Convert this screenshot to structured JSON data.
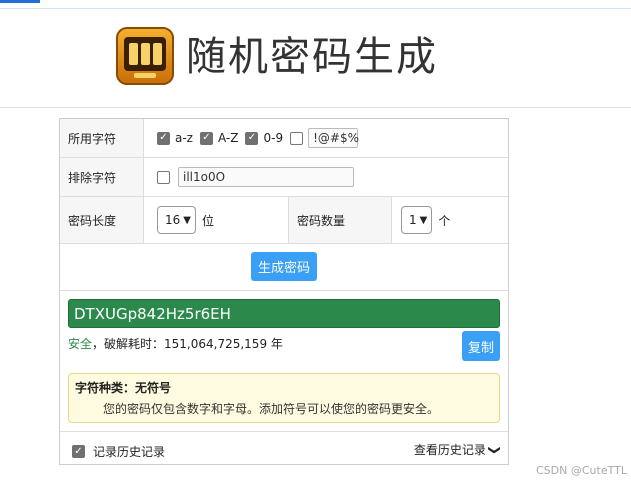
{
  "header": {
    "title": "随机密码生成",
    "logo_icon": "slot-machine-icon"
  },
  "options": {
    "chars_label": "所用字符",
    "lowercase": {
      "label": "a-z",
      "checked": true
    },
    "uppercase": {
      "label": "A-Z",
      "checked": true
    },
    "digits": {
      "label": "0-9",
      "checked": true
    },
    "symbols": {
      "checked": false,
      "value": "!@#$%"
    },
    "exclude_label": "排除字符",
    "exclude": {
      "checked": false,
      "value": "ill1o0O"
    },
    "length_label": "密码长度",
    "length_value": "16",
    "length_unit": "位",
    "count_label": "密码数量",
    "count_value": "1",
    "count_unit": "个"
  },
  "actions": {
    "generate_label": "生成密码",
    "copy_label": "复制"
  },
  "result": {
    "password": "DTXUGp842Hz5r6EH",
    "strength_label": "安全",
    "crack_time": "，破解耗时：151,064,725,159 年"
  },
  "info": {
    "title": "字符种类：无符号",
    "text": "您的密码仅包含数字和字母。添加符号可以使您的密码更安全。"
  },
  "history": {
    "record_label": "记录历史记录",
    "record_checked": true,
    "view_label": "查看历史记录"
  },
  "watermark": "CSDN @CuteTTL",
  "colors": {
    "accent": "#3aa0f5",
    "result_bg": "#2b8a4b",
    "info_bg": "#fffbe0"
  }
}
